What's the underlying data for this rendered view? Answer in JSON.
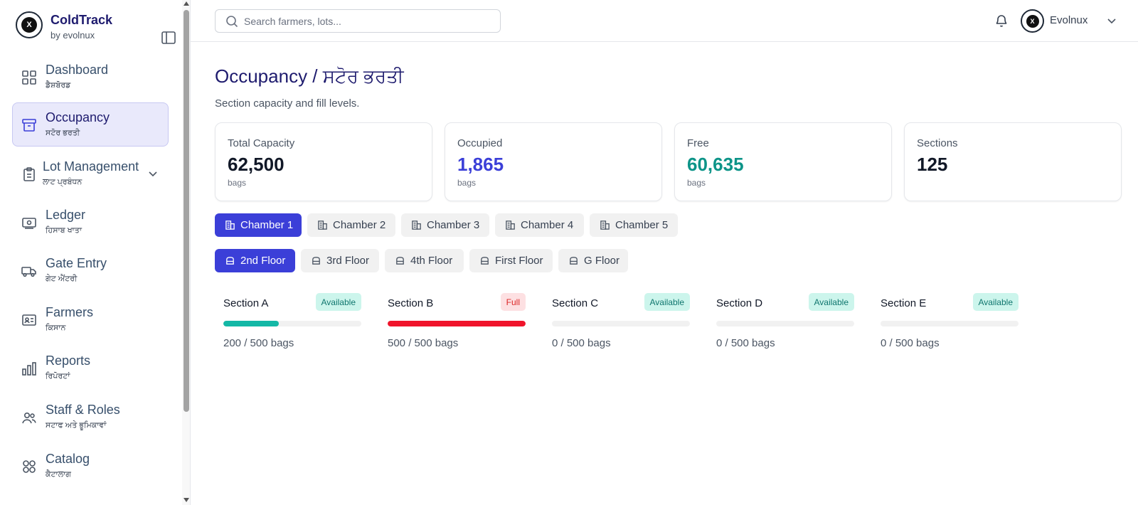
{
  "brand": {
    "name": "ColdTrack",
    "sub": "by evolnux",
    "logo_text": "X"
  },
  "nav": [
    {
      "label": "Dashboard",
      "sub": "ਡੈਸ਼ਬੋਰਡ",
      "icon": "grid-icon",
      "active": false
    },
    {
      "label": "Occupancy",
      "sub": "ਸਟੋਰ ਭਰਤੀ",
      "icon": "archive-icon",
      "active": true
    },
    {
      "label": "Lot Management",
      "sub": "ਲਾਟ ਪ੍ਰਬੰਧਨ",
      "icon": "clipboard-icon",
      "active": false,
      "expandable": true
    },
    {
      "label": "Ledger",
      "sub": "ਹਿਸਾਬ ਖਾਤਾ",
      "icon": "banknote-icon",
      "active": false
    },
    {
      "label": "Gate Entry",
      "sub": "ਗੇਟ ਐਂਟਰੀ",
      "icon": "truck-icon",
      "active": false
    },
    {
      "label": "Farmers",
      "sub": "ਕਿਸਾਨ",
      "icon": "id-card-icon",
      "active": false
    },
    {
      "label": "Reports",
      "sub": "ਰਿਪੋਰਟਾਂ",
      "icon": "bar-chart-icon",
      "active": false
    },
    {
      "label": "Staff & Roles",
      "sub": "ਸਟਾਫ ਅਤੇ ਭੂਮਿਕਾਵਾਂ",
      "icon": "users-icon",
      "active": false
    },
    {
      "label": "Catalog",
      "sub": "ਕੈਟਾਲਾਗ",
      "icon": "grid-circles-icon",
      "active": false
    }
  ],
  "header": {
    "search_placeholder": "Search farmers, lots...",
    "search_value": "",
    "user_name": "Evolnux"
  },
  "page": {
    "title": "Occupancy / ਸਟੋਰ ਭਰਤੀ",
    "subtitle": "Section capacity and fill levels."
  },
  "stats": [
    {
      "label": "Total Capacity",
      "value": "62,500",
      "unit": "bags",
      "color": "#111827"
    },
    {
      "label": "Occupied",
      "value": "1,865",
      "unit": "bags",
      "color": "#3b3fd8"
    },
    {
      "label": "Free",
      "value": "60,635",
      "unit": "bags",
      "color": "#0d9488"
    },
    {
      "label": "Sections",
      "value": "125",
      "unit": "",
      "color": "#111827"
    }
  ],
  "chambers": [
    {
      "label": "Chamber 1",
      "active": true
    },
    {
      "label": "Chamber 2",
      "active": false
    },
    {
      "label": "Chamber 3",
      "active": false
    },
    {
      "label": "Chamber 4",
      "active": false
    },
    {
      "label": "Chamber 5",
      "active": false
    }
  ],
  "floors": [
    {
      "label": "2nd Floor",
      "active": true
    },
    {
      "label": "3rd Floor",
      "active": false
    },
    {
      "label": "4th Floor",
      "active": false
    },
    {
      "label": "First Floor",
      "active": false
    },
    {
      "label": "G Floor",
      "active": false
    }
  ],
  "sections": [
    {
      "name": "Section A",
      "status": "Available",
      "used": 200,
      "capacity": 500,
      "count_text": "200 / 500 bags",
      "bar_color": "#14b8a6"
    },
    {
      "name": "Section B",
      "status": "Full",
      "used": 500,
      "capacity": 500,
      "count_text": "500 / 500 bags",
      "bar_color": "#f0142b"
    },
    {
      "name": "Section C",
      "status": "Available",
      "used": 0,
      "capacity": 500,
      "count_text": "0 / 500 bags",
      "bar_color": "#14b8a6"
    },
    {
      "name": "Section D",
      "status": "Available",
      "used": 0,
      "capacity": 500,
      "count_text": "0 / 500 bags",
      "bar_color": "#14b8a6"
    },
    {
      "name": "Section E",
      "status": "Available",
      "used": 0,
      "capacity": 500,
      "count_text": "0 / 500 bags",
      "bar_color": "#14b8a6"
    }
  ]
}
